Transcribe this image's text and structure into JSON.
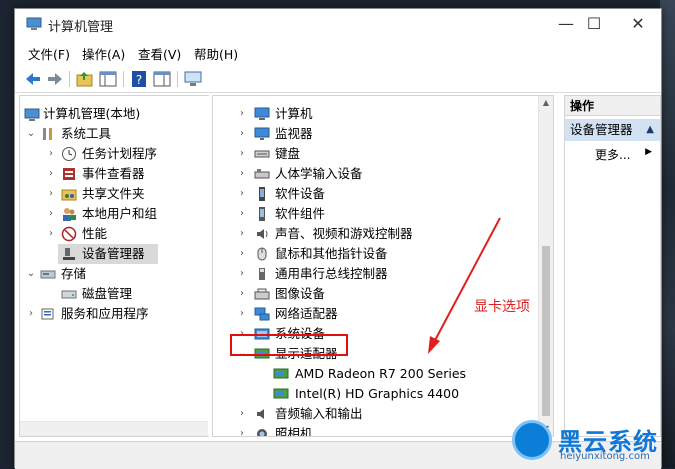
{
  "window": {
    "title": "计算机管理",
    "controls": {
      "minimize": "—",
      "maximize": "☐",
      "close": "✕"
    }
  },
  "menu": [
    "文件(F)",
    "操作(A)",
    "查看(V)",
    "帮助(H)"
  ],
  "toolbar": {
    "icons": [
      "back-icon",
      "forward-icon",
      "up-folder-icon",
      "show-hide-tree-icon",
      "help-icon",
      "properties-icon",
      "monitor-icon"
    ]
  },
  "tree": {
    "root": "计算机管理(本地)",
    "system_tools": "系统工具",
    "task_scheduler": "任务计划程序",
    "event_viewer": "事件查看器",
    "shared_folders": "共享文件夹",
    "local_users": "本地用户和组",
    "performance": "性能",
    "device_manager": "设备管理器",
    "storage": "存储",
    "disk_management": "磁盘管理",
    "services": "服务和应用程序"
  },
  "devices": {
    "computer": "计算机",
    "monitors": "监视器",
    "keyboards": "键盘",
    "hid": "人体学输入设备",
    "software_devices": "软件设备",
    "software_components": "软件组件",
    "audio": "声音、视频和游戏控制器",
    "mice": "鼠标和其他指针设备",
    "usb": "通用串行总线控制器",
    "imaging": "图像设备",
    "network": "网络适配器",
    "system": "系统设备",
    "display": "显示适配器",
    "gpu1": "AMD Radeon R7 200 Series",
    "gpu2": "Intel(R) HD Graphics 4400",
    "audio_io": "音频输入和输出",
    "camera": "照相机"
  },
  "actions": {
    "header": "操作",
    "group": "设备管理器",
    "more": "更多..."
  },
  "annotation": {
    "text": "显卡选项",
    "color": "#e02020"
  },
  "watermark": {
    "text": "黑云系统",
    "sub": "heiyunxitong.com"
  }
}
